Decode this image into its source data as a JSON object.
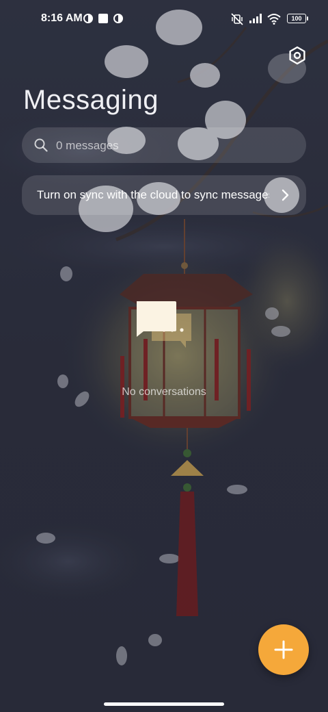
{
  "status_bar": {
    "time": "8:16 AM",
    "battery": "100"
  },
  "header": {
    "title": "Messaging",
    "settings_icon": "settings-icon"
  },
  "search": {
    "placeholder": "0 messages"
  },
  "sync_banner": {
    "text": "Turn on sync with the cloud to sync messages"
  },
  "empty_state": {
    "text": "No conversations"
  },
  "fab": {
    "icon": "plus-icon",
    "color": "#f5a83a"
  },
  "colors": {
    "background": "#2e3040",
    "accent": "#f5a83a"
  }
}
